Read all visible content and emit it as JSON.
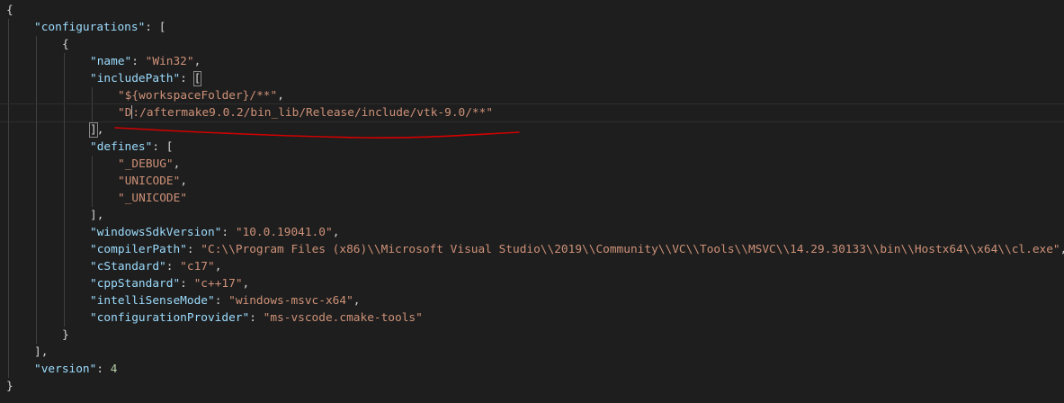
{
  "editor": {
    "language": "json",
    "colors": {
      "background": "#1e1e1e",
      "key": "#9cdcfe",
      "string": "#ce9178",
      "number": "#b5cea8",
      "punctuation": "#d4d4d4",
      "annotation": "#d40000"
    },
    "lines": [
      {
        "tokens": [
          {
            "t": "p",
            "v": "{"
          }
        ]
      },
      {
        "tokens": [
          {
            "t": "k",
            "v": "\"configurations\""
          },
          {
            "t": "p",
            "v": ": ["
          }
        ]
      },
      {
        "tokens": [
          {
            "t": "p",
            "v": "{"
          }
        ]
      },
      {
        "tokens": [
          {
            "t": "k",
            "v": "\"name\""
          },
          {
            "t": "p",
            "v": ": "
          },
          {
            "t": "s",
            "v": "\"Win32\""
          },
          {
            "t": "p",
            "v": ","
          }
        ]
      },
      {
        "tokens": [
          {
            "t": "k",
            "v": "\"includePath\""
          },
          {
            "t": "p",
            "v": ": "
          },
          {
            "t": "b",
            "v": "["
          }
        ]
      },
      {
        "tokens": [
          {
            "t": "s",
            "v": "\"${workspaceFolder}/**\""
          },
          {
            "t": "p",
            "v": ","
          }
        ]
      },
      {
        "tokens": [
          {
            "t": "s",
            "v": "\"D"
          },
          {
            "t": "c",
            "v": ""
          },
          {
            "t": "s",
            "v": ":/aftermake9.0.2/bin_lib/Release/include/vtk-9.0/**\""
          }
        ]
      },
      {
        "tokens": [
          {
            "t": "b",
            "v": "]"
          },
          {
            "t": "p",
            "v": ","
          }
        ]
      },
      {
        "tokens": [
          {
            "t": "k",
            "v": "\"defines\""
          },
          {
            "t": "p",
            "v": ": ["
          }
        ]
      },
      {
        "tokens": [
          {
            "t": "s",
            "v": "\"_DEBUG\""
          },
          {
            "t": "p",
            "v": ","
          }
        ]
      },
      {
        "tokens": [
          {
            "t": "s",
            "v": "\"UNICODE\""
          },
          {
            "t": "p",
            "v": ","
          }
        ]
      },
      {
        "tokens": [
          {
            "t": "s",
            "v": "\"_UNICODE\""
          }
        ]
      },
      {
        "tokens": [
          {
            "t": "p",
            "v": "],"
          }
        ]
      },
      {
        "tokens": [
          {
            "t": "k",
            "v": "\"windowsSdkVersion\""
          },
          {
            "t": "p",
            "v": ": "
          },
          {
            "t": "s",
            "v": "\"10.0.19041.0\""
          },
          {
            "t": "p",
            "v": ","
          }
        ]
      },
      {
        "tokens": [
          {
            "t": "k",
            "v": "\"compilerPath\""
          },
          {
            "t": "p",
            "v": ": "
          },
          {
            "t": "s",
            "v": "\"C:\\\\Program Files (x86)\\\\Microsoft Visual Studio\\\\2019\\\\Community\\\\VC\\\\Tools\\\\MSVC\\\\14.29.30133\\\\bin\\\\Hostx64\\\\x64\\\\cl.exe\""
          },
          {
            "t": "p",
            "v": ","
          }
        ]
      },
      {
        "tokens": [
          {
            "t": "k",
            "v": "\"cStandard\""
          },
          {
            "t": "p",
            "v": ": "
          },
          {
            "t": "s",
            "v": "\"c17\""
          },
          {
            "t": "p",
            "v": ","
          }
        ]
      },
      {
        "tokens": [
          {
            "t": "k",
            "v": "\"cppStandard\""
          },
          {
            "t": "p",
            "v": ": "
          },
          {
            "t": "s",
            "v": "\"c++17\""
          },
          {
            "t": "p",
            "v": ","
          }
        ]
      },
      {
        "tokens": [
          {
            "t": "k",
            "v": "\"intelliSenseMode\""
          },
          {
            "t": "p",
            "v": ": "
          },
          {
            "t": "s",
            "v": "\"windows-msvc-x64\""
          },
          {
            "t": "p",
            "v": ","
          }
        ]
      },
      {
        "tokens": [
          {
            "t": "k",
            "v": "\"configurationProvider\""
          },
          {
            "t": "p",
            "v": ": "
          },
          {
            "t": "s",
            "v": "\"ms-vscode.cmake-tools\""
          }
        ]
      },
      {
        "tokens": [
          {
            "t": "p",
            "v": "}"
          }
        ]
      },
      {
        "tokens": [
          {
            "t": "p",
            "v": "],"
          }
        ]
      },
      {
        "tokens": [
          {
            "t": "k",
            "v": "\"version\""
          },
          {
            "t": "p",
            "v": ": "
          },
          {
            "t": "n",
            "v": "4"
          }
        ]
      },
      {
        "tokens": [
          {
            "t": "p",
            "v": "}"
          }
        ]
      }
    ]
  }
}
